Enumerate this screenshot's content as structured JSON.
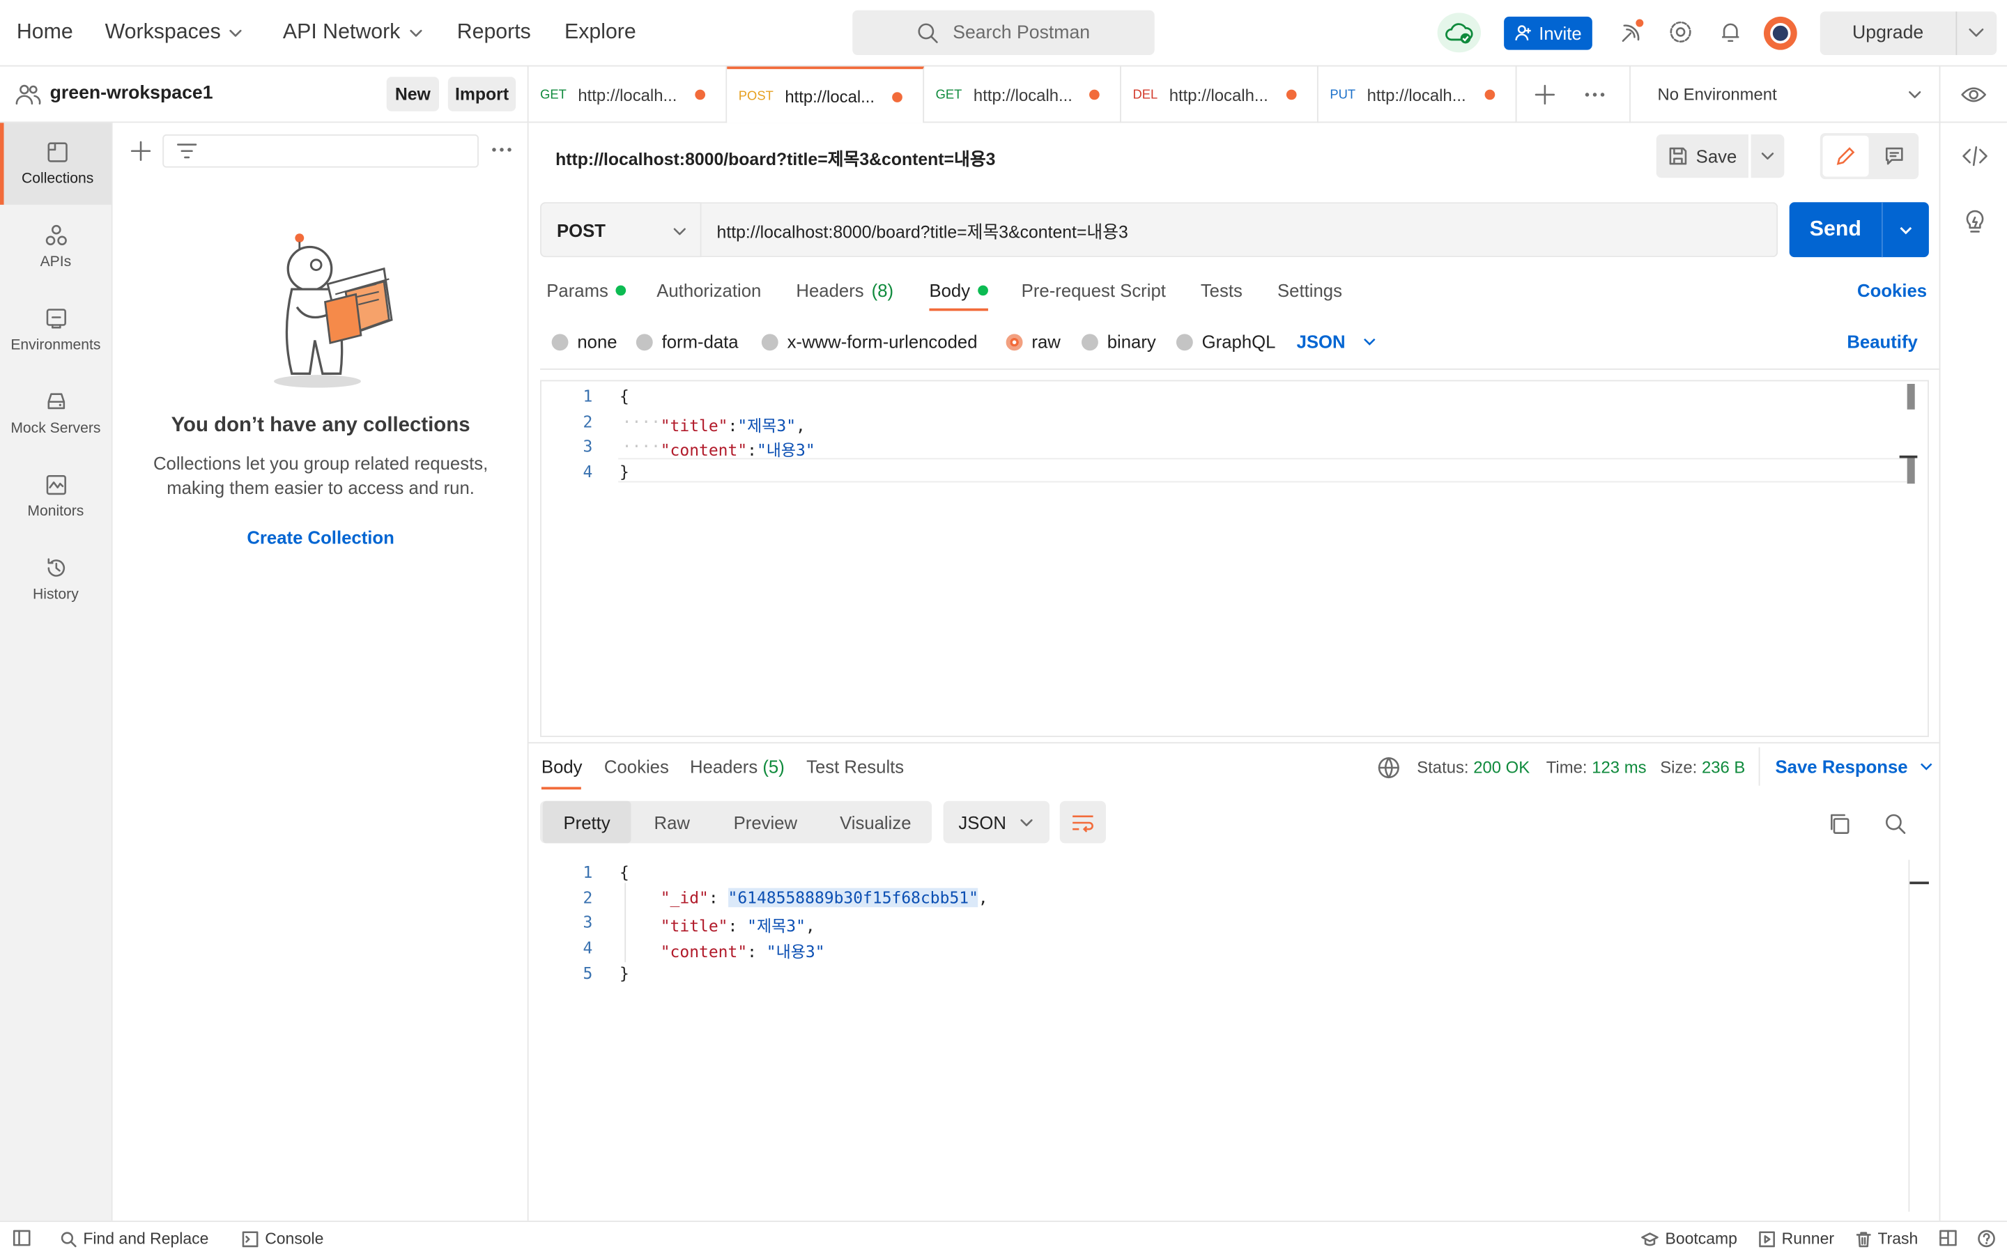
{
  "topbar": {
    "nav": [
      "Home",
      "Workspaces",
      "API Network",
      "Reports",
      "Explore"
    ],
    "search_placeholder": "Search Postman",
    "invite_label": "Invite",
    "upgrade_label": "Upgrade"
  },
  "workspace": {
    "name": "green-wrokspace1",
    "new_label": "New",
    "import_label": "Import"
  },
  "rail": {
    "items": [
      {
        "label": "Collections",
        "icon": "collections-icon"
      },
      {
        "label": "APIs",
        "icon": "apis-icon"
      },
      {
        "label": "Environments",
        "icon": "environments-icon"
      },
      {
        "label": "Mock Servers",
        "icon": "mock-servers-icon"
      },
      {
        "label": "Monitors",
        "icon": "monitors-icon"
      },
      {
        "label": "History",
        "icon": "history-icon"
      }
    ]
  },
  "collections": {
    "empty_title": "You don’t have any collections",
    "empty_desc_1": "Collections let you group related requests,",
    "empty_desc_2": "making them easier to access and run.",
    "create_label": "Create Collection"
  },
  "tabs": [
    {
      "method": "GET",
      "url": "http://localh...",
      "method_color": "#0f8a3c"
    },
    {
      "method": "POST",
      "url": "http://local...",
      "method_color": "#e6a020"
    },
    {
      "method": "GET",
      "url": "http://localh...",
      "method_color": "#0f8a3c"
    },
    {
      "method": "DEL",
      "url": "http://localh...",
      "method_color": "#d33b2c"
    },
    {
      "method": "PUT",
      "url": "http://localh...",
      "method_color": "#1a6fc9"
    }
  ],
  "environment": "No Environment",
  "request": {
    "title": "http://localhost:8000/board?title=제목3&content=내용3",
    "save_label": "Save",
    "method": "POST",
    "url": "http://localhost:8000/board?title=제목3&content=내용3",
    "send_label": "Send",
    "tabs": {
      "params": "Params",
      "authorization": "Authorization",
      "headers": "Headers",
      "headers_count": "(8)",
      "body": "Body",
      "prerequest": "Pre-request Script",
      "tests": "Tests",
      "settings": "Settings",
      "cookies": "Cookies"
    },
    "body_types": [
      "none",
      "form-data",
      "x-www-form-urlencoded",
      "raw",
      "binary",
      "GraphQL"
    ],
    "body_format": "JSON",
    "beautify_label": "Beautify",
    "lines": [
      "1",
      "2",
      "3",
      "4"
    ],
    "body_code": {
      "open": "{",
      "k1": "\"title\"",
      "v1": "\"제목3\"",
      "k2": "\"content\"",
      "v2": "\"내용3\"",
      "close": "}"
    }
  },
  "response": {
    "tabs": {
      "body": "Body",
      "cookies": "Cookies",
      "headers": "Headers",
      "headers_count": "(5)",
      "test_results": "Test Results"
    },
    "status_label": "Status:",
    "status_value": "200 OK",
    "time_label": "Time:",
    "time_value": "123 ms",
    "size_label": "Size:",
    "size_value": "236 B",
    "save_response_label": "Save Response",
    "views": [
      "Pretty",
      "Raw",
      "Preview",
      "Visualize"
    ],
    "format": "JSON",
    "lines": [
      "1",
      "2",
      "3",
      "4",
      "5"
    ],
    "body_code": {
      "open": "{",
      "k_id": "\"_id\"",
      "v_id": "\"6148558889b30f15f68cbb51\"",
      "k_title": "\"title\"",
      "v_title": "\"제목3\"",
      "k_content": "\"content\"",
      "v_content": "\"내용3\"",
      "close": "}"
    }
  },
  "statusbar": {
    "find_replace": "Find and Replace",
    "console": "Console",
    "bootcamp": "Bootcamp",
    "runner": "Runner",
    "trash": "Trash"
  },
  "colors": {
    "accent": "#f26b3a",
    "primary": "#0265d2",
    "success": "#0f8a3c"
  }
}
